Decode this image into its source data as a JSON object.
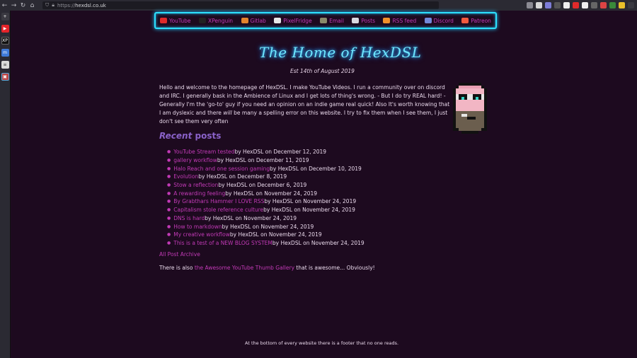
{
  "browser": {
    "back_icon": "arrow-left",
    "forward_icon": "arrow-right",
    "reload_icon": "reload",
    "home_icon": "home",
    "url_scheme": "https://",
    "url_host": "hexdsl.co.uk"
  },
  "sidebar": {
    "items": [
      {
        "name": "add",
        "glyph": "+",
        "color": "#3a3941"
      },
      {
        "name": "youtube",
        "glyph": "▶",
        "color": "#e5242a"
      },
      {
        "name": "xpenguin",
        "glyph": "XP",
        "color": "#111111"
      },
      {
        "name": "mastodon",
        "glyph": "m",
        "color": "#3f7ad8"
      },
      {
        "name": "document",
        "glyph": "≡",
        "color": "#dadada"
      },
      {
        "name": "gallery",
        "glyph": "▣",
        "color": "#b44"
      }
    ]
  },
  "nav": [
    {
      "label": "YouTube",
      "icon": "youtube-icon",
      "color": "#e02a2a"
    },
    {
      "label": "XPenguin",
      "icon": "xpenguin-icon",
      "color": "#222"
    },
    {
      "label": "Gitlab",
      "icon": "gitlab-icon",
      "color": "#e2832d"
    },
    {
      "label": "PixelFridge",
      "icon": "pixelfridge-icon",
      "color": "#e6e6e6"
    },
    {
      "label": "Email",
      "icon": "email-icon",
      "color": "#8a8a6a"
    },
    {
      "label": "Posts",
      "icon": "posts-icon",
      "color": "#d8d8e0"
    },
    {
      "label": "RSS feed",
      "icon": "rss-icon",
      "color": "#f0902a"
    },
    {
      "label": "Discord",
      "icon": "discord-icon",
      "color": "#7289da"
    },
    {
      "label": "Patreon",
      "icon": "patreon-icon",
      "color": "#f0593e"
    }
  ],
  "site": {
    "title": "The Home of HexDSL",
    "established": "Est 14th of August 2019",
    "intro_part1": "Hello and welcome to the homepage of HexDSL. I make YouTube Videos. I run a community over on discord and IRC. I generally bask in the Ambience of Linux and I get lots of thing's wrong. - But I do try REAL hard! - Generally I'm the 'go-to' guy if you need an opinion on an indie game real quick! Also It's worth knowing that I am dyslexic and there ",
    "intro_will": "will",
    "intro_part2": " be many a spelling error on this website. I try to fix them when I see them, I just don't see them very often",
    "recent_word": "Recent",
    "posts_word": " posts",
    "archive_label": "All Post Archive",
    "also_prefix": "There is also ",
    "also_link": "the Awesome YouTube Thumb Gallery",
    "also_suffix": " that is awesome... Obviously!",
    "footer": "At the bottom of every website there is a footer that no one reads."
  },
  "posts": [
    {
      "title": "YouTube Stream tested",
      "meta": " by HexDSL on December 12, 2019"
    },
    {
      "title": "gallery workflow",
      "meta": " by HexDSL on December 11, 2019"
    },
    {
      "title": "Halo Reach and one session gaming",
      "meta": " by HexDSL on December 10, 2019"
    },
    {
      "title": "Evolution",
      "meta": " by HexDSL on December 8, 2019"
    },
    {
      "title": "Stow a reflection",
      "meta": " by HexDSL on December 6, 2019"
    },
    {
      "title": "A rewarding feeling",
      "meta": " by HexDSL on November 24, 2019"
    },
    {
      "title": "By Grabthars Hammer I LOVE RSS",
      "meta": " by HexDSL on November 24, 2019"
    },
    {
      "title": "Capitalism stole reference culture",
      "meta": " by HexDSL on November 24, 2019"
    },
    {
      "title": "DNS is hard",
      "meta": " by HexDSL on November 24, 2019"
    },
    {
      "title": "How to markdown",
      "meta": " by HexDSL on November 24, 2019"
    },
    {
      "title": "My creative workflow",
      "meta": " by HexDSL on November 24, 2019"
    },
    {
      "title": "This is a test of a NEW BLOG SYSTEM",
      "meta": " by HexDSL on November 24, 2019"
    }
  ]
}
